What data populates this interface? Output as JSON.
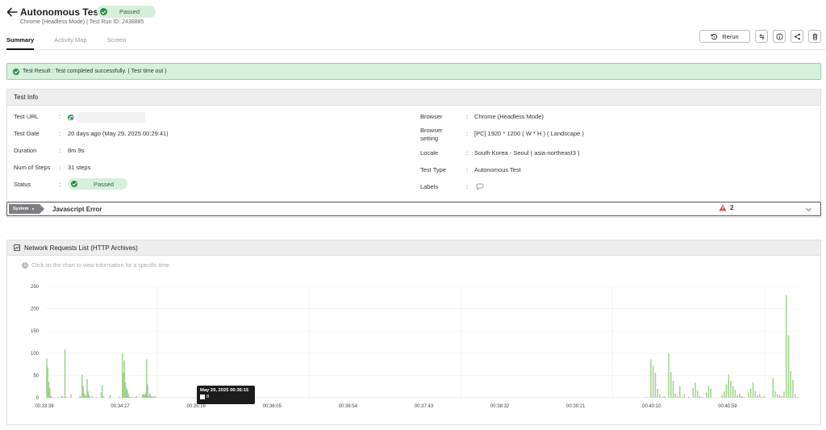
{
  "header": {
    "title": "Autonomous Test",
    "status": "Passed",
    "subtitle": "Chrome (Headless Mode) | Test Run ID: 2438885",
    "tabs": [
      {
        "label": "Summary",
        "active": true
      },
      {
        "label": "Activity Map",
        "active": false
      },
      {
        "label": "Screen",
        "active": false
      }
    ],
    "rerun_label": "Rerun",
    "toolbar_icons": [
      "swap-icon",
      "info-icon",
      "share-icon",
      "trash-icon"
    ]
  },
  "result_banner": {
    "text": "Test Result : Test completed successfully. ( Test time out )"
  },
  "test_info": {
    "title": "Test Info",
    "left": [
      {
        "label": "Test URL",
        "value": ""
      },
      {
        "label": "Test Date",
        "value": "20 days ago (May 29, 2025 00:29:41)"
      },
      {
        "label": "Duration",
        "value": "8m 9s"
      },
      {
        "label": "Num of Steps",
        "value": "31 steps"
      },
      {
        "label": "Status",
        "value": "Passed"
      }
    ],
    "right": [
      {
        "label": "Browser",
        "value": "Chrome (Headless Mode)"
      },
      {
        "label": "Browser setting",
        "value": "[PC] 1920 * 1200 ( W * H ) ( Landscape )"
      },
      {
        "label": "Locale",
        "value": "South Korea - Seoul  ( asia-northeast3 )"
      },
      {
        "label": "Test Type",
        "value": "Autonomous Test"
      },
      {
        "label": "Labels",
        "value": ""
      }
    ]
  },
  "js_error": {
    "tag": "System",
    "title": "Javascript Error",
    "count": "2"
  },
  "network": {
    "title": "Network Requests List (HTTP Archives)",
    "hint": "Click on the chart to view information for a specific time.",
    "tooltip": {
      "time": "May 29, 2025 00:35:15",
      "value": "8"
    }
  },
  "colors": {
    "bar": "#9fd38a",
    "pass_green": "#2f8a4a",
    "banner_bg": "#d5f0dc",
    "warn_red": "#d9534f"
  },
  "chart_data": {
    "type": "bar",
    "yticks": [
      0,
      50,
      100,
      150,
      200,
      250
    ],
    "ylim": [
      0,
      250
    ],
    "xticks": [
      "00:33:38",
      "00:34:27",
      "00:35:16",
      "00:36:05",
      "00:36:54",
      "00:37:43",
      "00:38:32",
      "00:39:21",
      "00:40:10",
      "00:40:59"
    ],
    "grid": true,
    "values": [
      0,
      88,
      68,
      36,
      22,
      4,
      2,
      0,
      0,
      0,
      0,
      0,
      2,
      0,
      0,
      2,
      4,
      0,
      2,
      108,
      2,
      0,
      0,
      0,
      0,
      8,
      0,
      0,
      0,
      0,
      0,
      0,
      0,
      0,
      4,
      2,
      52,
      26,
      10,
      6,
      4,
      42,
      14,
      6,
      2,
      0,
      4,
      0,
      0,
      0,
      2,
      0,
      0,
      0,
      0,
      12,
      28,
      4,
      0,
      0,
      0,
      0,
      0,
      2,
      6,
      0,
      0,
      0,
      0,
      0,
      0,
      0,
      0,
      2,
      0,
      0,
      100,
      56,
      84,
      34,
      22,
      16,
      8,
      2,
      2,
      0,
      2,
      0,
      0,
      2,
      4,
      0,
      0,
      0,
      0,
      0,
      8,
      8,
      6,
      12,
      86,
      30,
      4,
      10,
      6,
      2,
      2,
      4,
      0,
      4,
      0,
      0,
      0,
      0,
      0,
      0,
      0,
      0,
      0,
      0,
      0,
      0,
      0,
      0,
      0,
      0,
      0,
      0,
      0,
      0,
      0,
      0,
      0,
      0,
      0,
      0,
      0,
      0,
      0,
      0,
      0,
      0,
      0,
      0,
      0,
      0,
      0,
      0,
      0,
      0,
      0,
      0,
      0,
      0,
      0,
      0,
      0,
      0,
      0,
      0,
      0,
      0,
      0,
      0,
      0,
      0,
      0,
      0,
      0,
      0,
      0,
      0,
      0,
      0,
      0,
      0,
      0,
      0,
      0,
      0,
      0,
      0,
      0,
      0,
      0,
      0,
      0,
      0,
      0,
      0,
      0,
      0,
      0,
      0,
      0,
      0,
      0,
      0,
      0,
      0,
      0,
      0,
      0,
      0,
      0,
      0,
      0,
      0,
      0,
      0,
      0,
      0,
      0,
      0,
      0,
      0,
      0,
      0,
      0,
      0,
      0,
      0,
      0,
      0,
      0,
      0,
      0,
      0,
      0,
      0,
      0,
      0,
      0,
      0,
      0,
      0,
      0,
      0,
      0,
      0,
      0,
      0,
      0,
      0,
      0,
      0,
      0,
      0,
      0,
      0,
      0,
      0,
      0,
      0,
      0,
      0,
      0,
      0,
      0,
      0,
      0,
      0,
      0,
      0,
      0,
      0,
      0,
      0,
      0,
      0,
      0,
      0,
      0,
      0,
      0,
      0,
      0,
      0,
      0,
      0,
      0,
      0,
      0,
      0,
      0,
      0,
      0,
      0,
      0,
      0,
      0,
      0,
      0,
      0,
      0,
      0,
      0,
      0,
      0,
      0,
      0,
      0,
      0,
      0,
      0,
      0,
      0,
      0,
      0,
      0,
      0,
      0,
      0,
      0,
      0,
      0,
      0,
      0,
      0,
      0,
      0,
      0,
      0,
      0,
      0,
      0,
      0,
      0,
      0,
      0,
      0,
      0,
      0,
      0,
      0,
      0,
      0,
      0,
      0,
      0,
      0,
      0,
      0,
      0,
      0,
      0,
      0,
      0,
      0,
      0,
      0,
      0,
      0,
      0,
      0,
      0,
      0,
      0,
      0,
      0,
      0,
      0,
      0,
      0,
      0,
      0,
      0,
      0,
      0,
      0,
      0,
      0,
      0,
      0,
      0,
      0,
      0,
      0,
      0,
      0,
      0,
      0,
      0,
      0,
      0,
      0,
      0,
      0,
      0,
      0,
      0,
      0,
      0,
      0,
      0,
      0,
      0,
      0,
      0,
      0,
      0,
      0,
      0,
      0,
      0,
      0,
      0,
      0,
      0,
      0,
      0,
      0,
      0,
      0,
      0,
      0,
      0,
      0,
      0,
      0,
      0,
      0,
      0,
      0,
      0,
      0,
      0,
      0,
      0,
      0,
      0,
      0,
      0,
      0,
      0,
      0,
      0,
      0,
      0,
      0,
      0,
      0,
      0,
      0,
      0,
      0,
      0,
      0,
      0,
      0,
      0,
      0,
      0,
      0,
      0,
      0,
      0,
      0,
      0,
      0,
      0,
      0,
      0,
      0,
      0,
      0,
      0,
      0,
      0,
      0,
      0,
      0,
      0,
      0,
      0,
      0,
      0,
      0,
      0,
      0,
      0,
      0,
      0,
      0,
      0,
      0,
      0,
      0,
      0,
      0,
      0,
      0,
      0,
      0,
      0,
      0,
      0,
      0,
      0,
      0,
      0,
      0,
      0,
      0,
      0,
      0,
      0,
      0,
      0,
      0,
      0,
      0,
      0,
      0,
      0,
      0,
      0,
      0,
      0,
      0,
      0,
      0,
      0,
      0,
      0,
      0,
      0,
      0,
      0,
      0,
      0,
      0,
      0,
      0,
      0,
      0,
      0,
      0,
      0,
      0,
      0,
      0,
      0,
      0,
      0,
      0,
      0,
      0,
      0,
      0,
      0,
      0,
      0,
      0,
      0,
      0,
      0,
      0,
      0,
      0,
      0,
      0,
      0,
      0,
      0,
      0,
      0,
      0,
      0,
      0,
      0,
      0,
      0,
      0,
      0,
      0,
      0,
      0,
      0,
      0,
      0,
      0,
      0,
      0,
      0,
      0,
      0,
      0,
      0,
      0,
      0,
      0,
      0,
      0,
      0,
      0,
      0,
      0,
      0,
      0,
      0,
      0,
      0,
      0,
      0,
      0,
      0,
      0,
      0,
      0,
      0,
      0,
      0,
      0,
      0,
      0,
      0,
      0,
      0,
      0,
      0,
      0,
      0,
      0,
      0,
      0,
      0,
      0,
      0,
      0,
      0,
      0,
      0,
      0,
      0,
      0,
      0,
      0,
      0,
      0,
      0,
      0,
      0,
      0,
      0,
      0,
      0,
      0,
      0,
      0,
      0,
      0,
      0,
      0,
      0,
      0,
      0,
      0,
      0,
      0,
      0,
      0,
      0,
      0,
      0,
      0,
      0,
      0,
      0,
      0,
      0,
      0,
      0,
      0,
      0,
      0,
      0,
      0,
      0,
      0,
      0,
      0,
      0,
      0,
      0,
      0,
      0,
      0,
      0,
      0,
      0,
      0,
      0,
      0,
      0,
      0,
      0,
      0,
      0,
      0,
      0,
      0,
      0,
      0,
      0,
      0,
      0,
      0,
      0,
      0,
      0,
      0,
      0,
      0,
      0,
      0,
      0,
      0,
      0,
      0,
      0,
      0,
      0,
      0,
      0,
      0,
      0,
      0,
      0,
      0,
      0,
      0,
      0,
      0,
      0,
      0,
      0,
      0,
      0,
      0,
      0,
      0,
      0,
      0,
      0,
      0,
      0,
      0,
      0,
      0,
      0,
      0,
      0,
      0,
      0,
      0,
      0,
      0,
      0,
      0,
      0,
      0,
      0,
      0,
      0,
      0,
      0,
      0,
      0,
      0,
      0,
      0,
      0,
      0,
      0,
      0,
      0,
      0,
      0,
      0,
      0,
      0,
      0,
      0,
      0,
      0,
      0,
      0,
      0,
      0,
      0,
      0,
      0,
      0,
      0,
      0,
      0,
      0,
      0,
      0,
      0,
      0,
      0,
      0,
      0,
      0,
      0,
      0,
      0,
      0,
      0,
      0,
      0,
      0,
      0,
      0,
      0,
      0,
      0,
      0,
      0,
      0,
      0,
      0,
      0,
      0,
      0,
      0,
      0,
      0,
      0,
      0,
      0,
      0,
      0,
      0,
      0,
      0,
      0,
      0,
      0,
      0,
      0,
      0,
      0,
      0,
      0,
      0,
      0,
      0,
      0,
      0,
      0,
      0,
      0,
      0,
      0,
      0,
      0,
      0,
      0,
      0,
      0,
      0,
      0,
      0,
      0,
      0,
      0,
      0,
      0,
      0,
      0,
      0,
      0,
      0,
      0,
      0,
      0,
      0,
      0,
      0,
      0,
      0,
      0,
      0,
      0,
      0,
      0,
      0,
      0,
      0,
      0,
      0,
      0,
      0,
      0,
      0,
      0,
      0,
      0,
      0,
      0,
      0,
      0,
      0,
      0,
      0,
      0,
      0,
      0,
      0,
      0,
      0,
      0,
      0,
      0,
      0,
      0,
      0,
      0,
      0,
      0,
      0,
      0,
      0,
      0,
      0,
      0,
      0,
      0,
      0,
      0,
      0,
      0,
      0,
      0,
      0,
      0,
      0,
      0,
      0,
      0,
      0,
      0,
      0,
      0,
      0,
      0,
      0,
      0,
      0,
      0,
      0,
      0,
      0,
      0,
      0,
      0,
      0,
      0,
      0,
      0,
      0,
      0,
      0,
      0,
      0,
      0,
      0,
      0,
      0,
      0,
      0,
      0,
      0,
      0,
      0,
      0,
      0,
      0,
      0,
      0,
      0,
      0,
      0,
      0,
      0,
      0,
      0,
      0,
      0,
      0,
      0,
      0,
      0,
      0,
      0,
      0,
      0,
      0,
      0,
      0,
      0,
      0,
      0,
      0,
      0,
      0,
      0,
      0,
      0,
      0,
      0,
      0,
      0,
      0,
      0,
      0,
      0,
      0,
      0,
      0,
      0,
      0,
      0,
      0,
      0,
      0,
      0,
      0,
      0,
      0,
      0,
      0,
      0,
      0,
      0,
      0,
      0,
      0,
      0,
      0,
      0,
      0,
      0,
      0,
      0,
      0,
      0,
      0,
      0,
      0,
      0,
      0,
      0,
      0,
      0,
      0,
      0,
      0,
      0,
      0,
      0,
      0,
      0,
      0,
      0,
      0,
      0,
      0,
      0,
      0,
      0,
      0,
      0,
      0,
      0,
      0,
      0,
      0,
      0,
      0,
      0,
      0,
      0,
      0,
      0,
      0,
      0,
      0,
      0,
      0,
      0,
      0,
      0,
      0,
      0,
      0,
      0,
      0,
      0,
      0,
      0,
      0,
      0,
      0,
      0,
      0,
      0,
      0,
      0,
      0,
      0,
      0,
      0,
      0,
      0,
      0,
      0,
      0,
      0,
      0,
      0,
      0,
      0,
      0,
      0,
      0,
      0,
      0,
      0,
      0,
      0,
      0,
      0,
      0,
      0,
      0,
      0,
      0,
      0,
      0,
      0,
      0,
      0,
      0,
      0,
      0,
      0,
      0,
      0,
      0,
      0,
      0,
      0,
      0,
      0,
      0,
      0,
      0,
      0,
      0,
      0,
      0,
      0,
      0,
      0,
      0,
      0,
      0,
      0,
      0,
      0,
      0,
      0,
      0,
      0,
      0,
      0,
      0,
      0,
      0,
      0,
      0,
      0,
      0,
      0,
      0,
      0
    ],
    "late_values": [
      0,
      2,
      0,
      86,
      72,
      56,
      20,
      8,
      2,
      4,
      0,
      100,
      58,
      38,
      10,
      4,
      26,
      2,
      8,
      0,
      2,
      0,
      22,
      34,
      16,
      4,
      2,
      0,
      12,
      26,
      20,
      0,
      0,
      0,
      0,
      6,
      14,
      30,
      52,
      38,
      26,
      18,
      6,
      10,
      4,
      2,
      0,
      12,
      20,
      34,
      14,
      6,
      8,
      2,
      4,
      0,
      0,
      0,
      44,
      14,
      8,
      6,
      4,
      14,
      230,
      140,
      60,
      40,
      8,
      2
    ]
  }
}
